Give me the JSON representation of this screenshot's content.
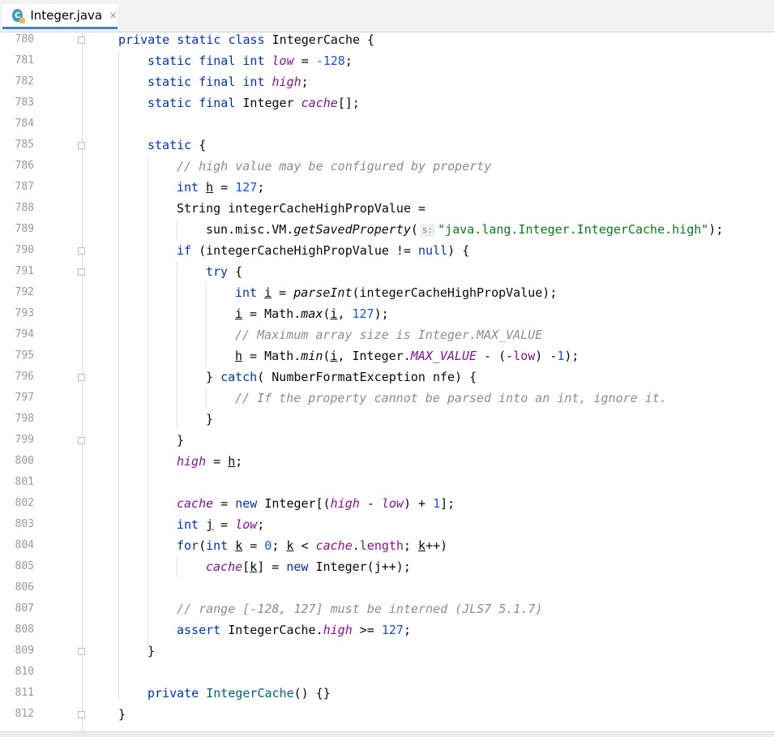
{
  "tab": {
    "icon_letter": "C",
    "label": "Integer.java",
    "close": "×"
  },
  "line_numbers": [
    "780",
    "781",
    "782",
    "783",
    "784",
    "785",
    "786",
    "787",
    "788",
    "789",
    "790",
    "791",
    "792",
    "793",
    "794",
    "795",
    "796",
    "797",
    "798",
    "799",
    "800",
    "801",
    "802",
    "803",
    "804",
    "805",
    "806",
    "807",
    "808",
    "809",
    "810",
    "811",
    "812"
  ],
  "code": {
    "l780": {
      "t1": "private static class ",
      "t2": "IntegerCache {"
    },
    "l781": {
      "t1": "static final int ",
      "t2": "low",
      "t3": " = ",
      "t4": "-128",
      "t5": ";"
    },
    "l782": {
      "t1": "static final int ",
      "t2": "high",
      "t3": ";"
    },
    "l783": {
      "t1": "static final ",
      "t2": "Integer ",
      "t3": "cache",
      "t4": "[];"
    },
    "l785": {
      "t1": "static",
      "t2": " {"
    },
    "l786": {
      "t1": "// high value may be configured by property"
    },
    "l787": {
      "t1": "int ",
      "t2": "h",
      "t3": " = ",
      "t4": "127",
      "t5": ";"
    },
    "l788": {
      "t1": "String integerCacheHighPropValue ="
    },
    "l789": {
      "t1": "sun.misc.VM.",
      "t2": "getSavedProperty",
      "t3": "(",
      "hint": "s:",
      "t4": "\"java.lang.Integer.IntegerCache.high\"",
      "t5": ");"
    },
    "l790": {
      "t1": "if",
      "t2": " (integerCacheHighPropValue != ",
      "t3": "null",
      "t4": ") {"
    },
    "l791": {
      "t1": "try",
      "t2": " {"
    },
    "l792": {
      "t1": "int ",
      "t2": "i",
      "t3": " = ",
      "t4": "parseInt",
      "t5": "(integerCacheHighPropValue);"
    },
    "l793": {
      "t1": "i",
      "t2": " = Math.",
      "t3": "max",
      "t4": "(",
      "t5": "i",
      "t6": ", ",
      "t7": "127",
      "t8": ");"
    },
    "l794": {
      "t1": "// Maximum array size is Integer.MAX_VALUE"
    },
    "l795": {
      "t1": "h",
      "t2": " = Math.",
      "t3": "min",
      "t4": "(",
      "t5": "i",
      "t6": ", Integer.",
      "t7": "MAX_VALUE",
      "t8": " - (-",
      "t9": "low",
      "t10": ") -",
      "t11": "1",
      "t12": ");"
    },
    "l796": {
      "t1": "} ",
      "t2": "catch",
      "t3": "( NumberFormatException nfe) {"
    },
    "l797": {
      "t1": "// If the property cannot be parsed into an int, ignore it."
    },
    "l798": {
      "t1": "}"
    },
    "l799": {
      "t1": "}"
    },
    "l800": {
      "t1": "high",
      "t2": " = ",
      "t3": "h",
      "t4": ";"
    },
    "l802": {
      "t1": "cache",
      "t2": " = ",
      "t3": "new ",
      "t4": "Integer[(",
      "t5": "high",
      "t6": " - ",
      "t7": "low",
      "t8": ") + ",
      "t9": "1",
      "t10": "];"
    },
    "l803": {
      "t1": "int ",
      "t2": "j",
      "t3": " = ",
      "t4": "low",
      "t5": ";"
    },
    "l804": {
      "t1": "for",
      "t2": "(",
      "t3": "int ",
      "t4": "k",
      "t5": " = ",
      "t6": "0",
      "t7": "; ",
      "t8": "k",
      "t9": " < ",
      "t10": "cache",
      "t11": ".",
      "t12": "length",
      "t13": "; ",
      "t14": "k",
      "t15": "++)"
    },
    "l805": {
      "t1": "cache",
      "t2": "[",
      "t3": "k",
      "t4": "] = ",
      "t5": "new ",
      "t6": "Integer(j++);"
    },
    "l807": {
      "t1": "// range [-128, 127] must be interned (JLS7 5.1.7)"
    },
    "l808": {
      "t1": "assert ",
      "t2": "IntegerCache.",
      "t3": "high",
      "t4": " >= ",
      "t5": "127",
      "t6": ";"
    },
    "l809": {
      "t1": "}"
    },
    "l811": {
      "t1": "private ",
      "t2": "IntegerCache",
      "t3": "() {}"
    },
    "l812": {
      "t1": "}"
    }
  },
  "colors": {
    "keyword": "#0033b3",
    "field": "#871094",
    "number": "#1750eb",
    "string": "#067d17",
    "comment": "#8c8c8c",
    "method": "#00627a"
  }
}
